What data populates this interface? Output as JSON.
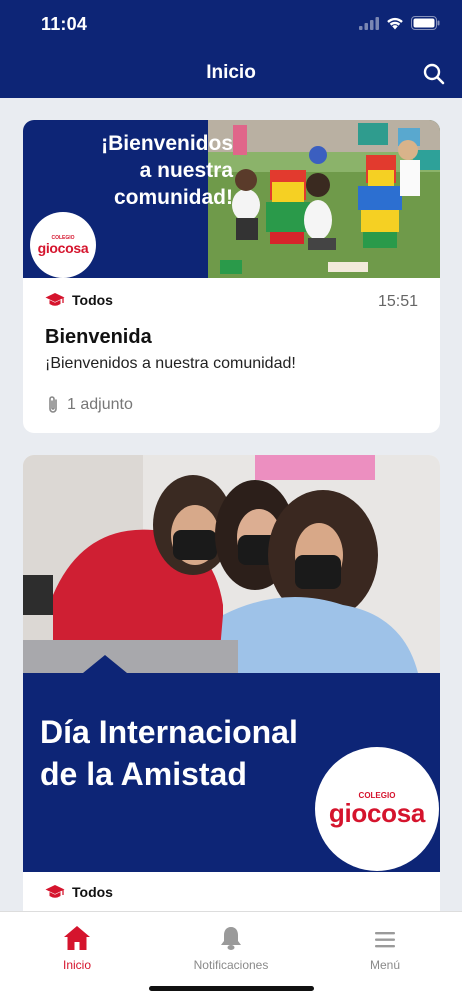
{
  "status": {
    "time": "11:04"
  },
  "header": {
    "title": "Inicio"
  },
  "posts": [
    {
      "banner_text_1": "¡Bienvenidos",
      "banner_text_2": "a nuestra",
      "banner_text_3": "comunidad!",
      "logo_small": "COLEGIO",
      "logo_big": "giocosa",
      "audience": "Todos",
      "time": "15:51",
      "title": "Bienvenida",
      "text": "¡Bienvenidos a nuestra comunidad!",
      "attachments": "1 adjunto"
    },
    {
      "banner_text_1": "Día Internacional",
      "banner_text_2": "de la Amistad",
      "logo_small": "COLEGIO",
      "logo_big": "giocosa",
      "audience": "Todos"
    }
  ],
  "tabs": [
    {
      "label": "Inicio",
      "icon": "home-icon",
      "active": true
    },
    {
      "label": "Notificaciones",
      "icon": "bell-icon",
      "active": false
    },
    {
      "label": "Menú",
      "icon": "menu-icon",
      "active": false
    }
  ],
  "colors": {
    "header": "#0d2576",
    "accent": "#d5142d",
    "background": "#e9ecf1",
    "inactive": "#8a8a8a"
  }
}
